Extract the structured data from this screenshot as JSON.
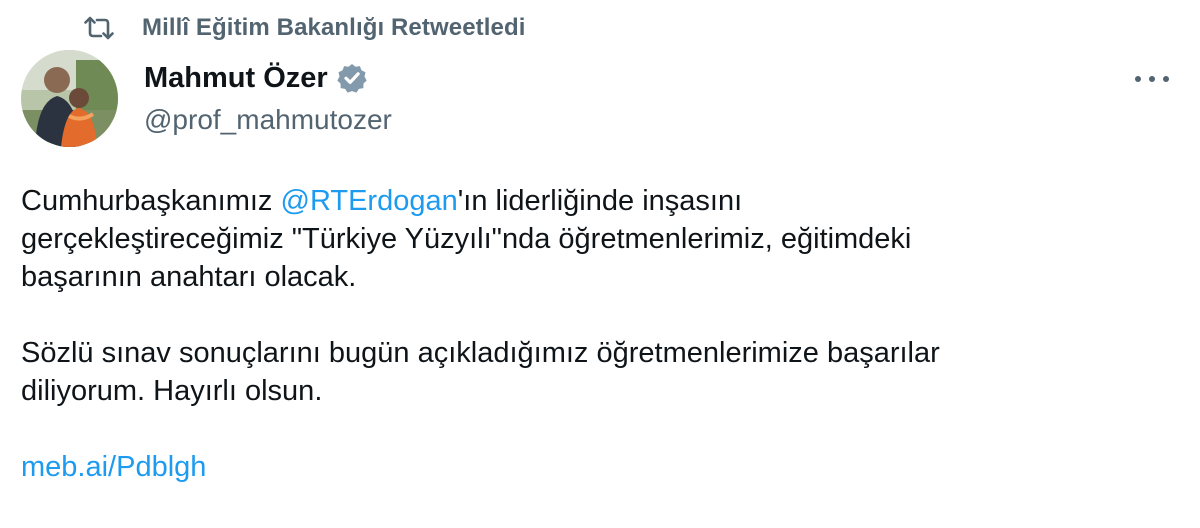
{
  "social_context": {
    "icon": "retweet-icon",
    "text": "Millî Eğitim Bakanlığı Retweetledi"
  },
  "author": {
    "avatar": "avatar-photo",
    "name": "Mahmut Özer",
    "verified_icon": "verified-badge-icon",
    "handle": "@prof_mahmutozer"
  },
  "more_icon": "more-options-icon",
  "tweet": {
    "p1_before": "Cumhurbaşkanımız ",
    "mention": "@RTErdogan",
    "p1_after": "'ın liderliğinde inşasını",
    "line2": "gerçekleştireceğimiz \"Türkiye Yüzyılı\"nda öğretmenlerimiz, eğitimdeki",
    "line3": "başarının anahtarı olacak.",
    "p2_line1": "Sözlü sınav sonuçlarını bugün açıkladığımız öğretmenlerimize başarılar",
    "p2_line2": "diliyorum. Hayırlı olsun.",
    "link": "meb.ai/Pdblgh"
  },
  "colors": {
    "text": "#0f1419",
    "secondary": "#536471",
    "link": "#1d9bf0",
    "verified": "#829aab"
  }
}
